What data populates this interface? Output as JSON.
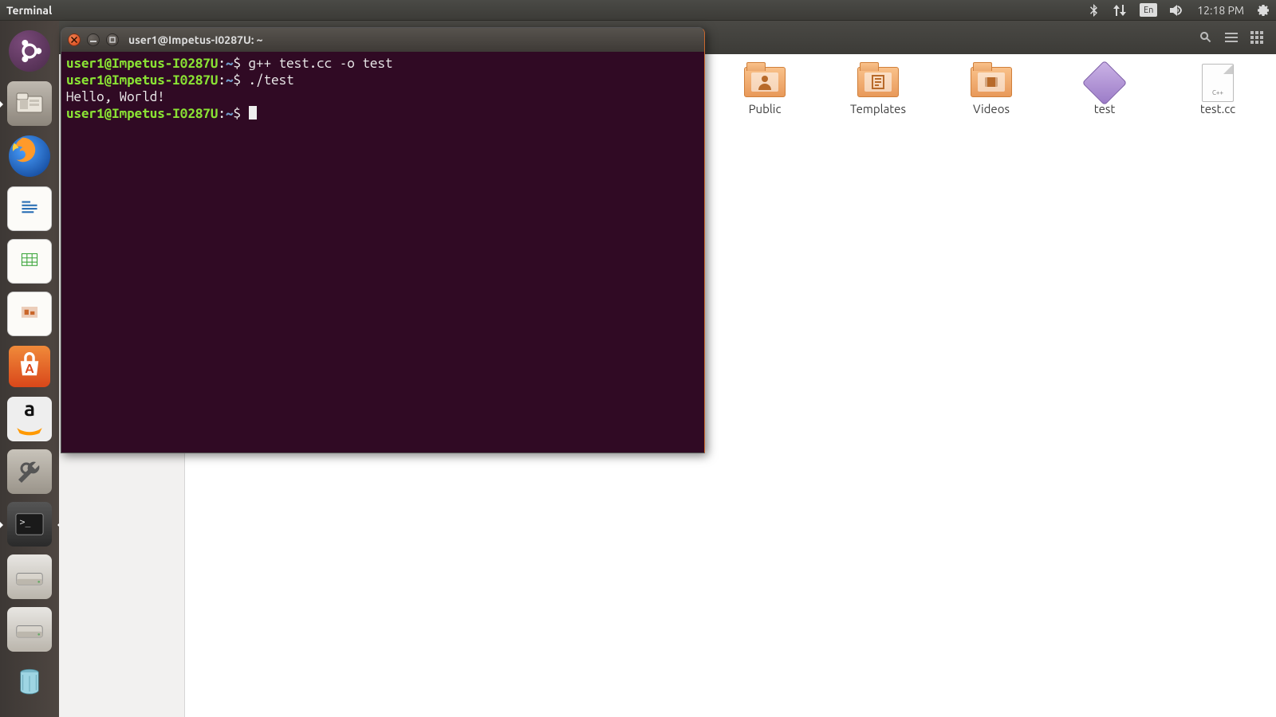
{
  "toppanel": {
    "app_title": "Terminal",
    "lang": "En",
    "clock": "12:18 PM"
  },
  "launcher": [
    {
      "name": "dash",
      "kind": "ubuntu"
    },
    {
      "name": "files",
      "kind": "files",
      "running": true
    },
    {
      "name": "firefox",
      "kind": "firefox"
    },
    {
      "name": "writer",
      "kind": "writer"
    },
    {
      "name": "calc",
      "kind": "calc"
    },
    {
      "name": "impress",
      "kind": "impress"
    },
    {
      "name": "software",
      "kind": "software"
    },
    {
      "name": "amazon",
      "kind": "amazon"
    },
    {
      "name": "settings",
      "kind": "settings"
    },
    {
      "name": "terminal",
      "kind": "terminal",
      "running": true,
      "active": true
    },
    {
      "name": "disk1",
      "kind": "disk"
    },
    {
      "name": "disk2",
      "kind": "disk"
    },
    {
      "name": "trash",
      "kind": "trash"
    }
  ],
  "files": {
    "items": [
      {
        "label": "Public",
        "type": "folder",
        "glyph": "person"
      },
      {
        "label": "Templates",
        "type": "folder",
        "glyph": "template"
      },
      {
        "label": "Videos",
        "type": "folder",
        "glyph": "video"
      },
      {
        "label": "test",
        "type": "exec"
      },
      {
        "label": "test.cc",
        "type": "doc",
        "tag": "C++"
      }
    ]
  },
  "terminal": {
    "title": "user1@Impetus-I0287U: ~",
    "prompt_user": "user1@Impetus-I0287U",
    "prompt_path": "~",
    "lines": [
      {
        "type": "cmd",
        "text": "g++ test.cc -o test"
      },
      {
        "type": "cmd",
        "text": "./test"
      },
      {
        "type": "out",
        "text": "Hello, World!"
      },
      {
        "type": "cmd",
        "text": ""
      }
    ]
  }
}
